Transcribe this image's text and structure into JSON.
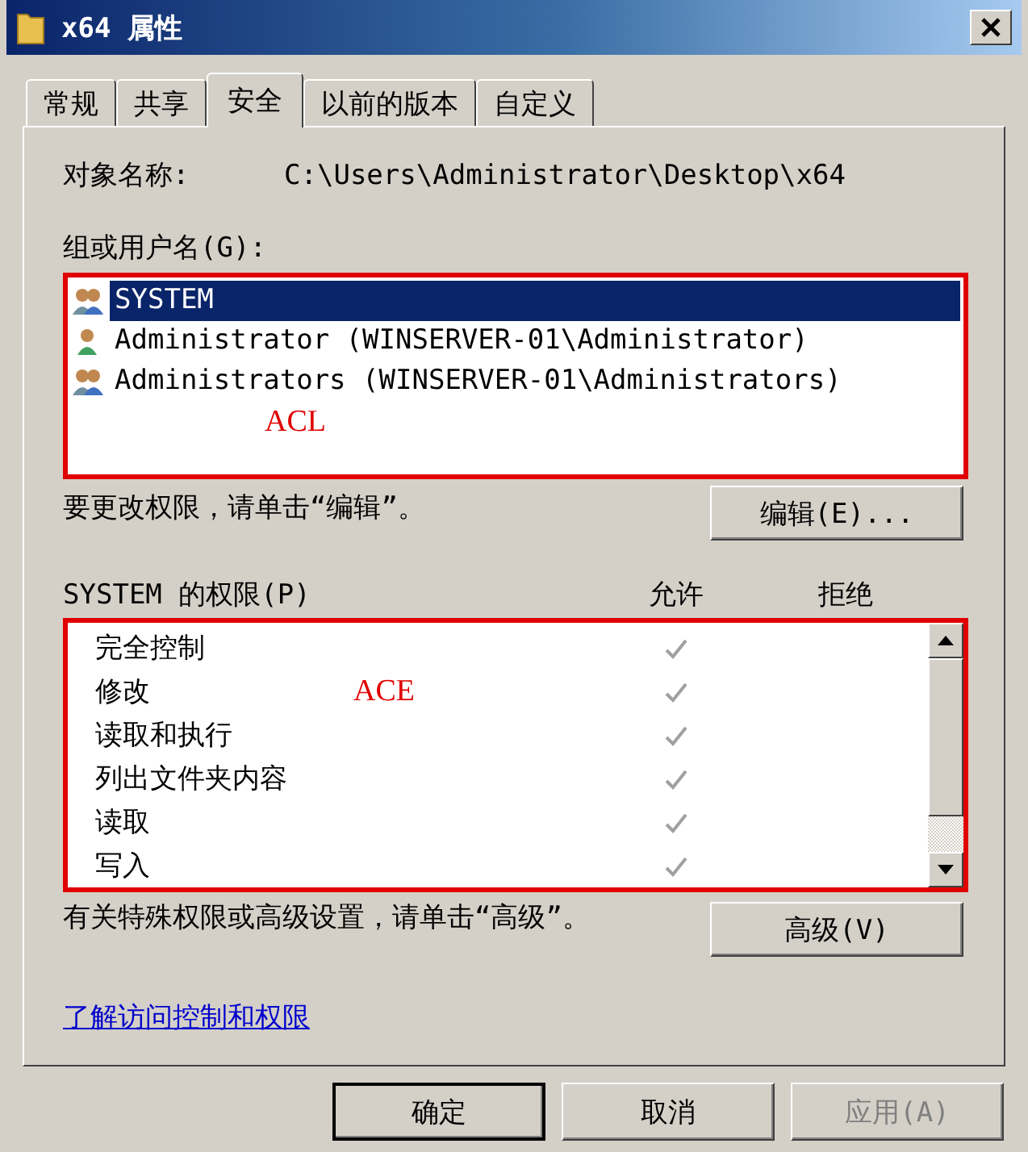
{
  "window": {
    "title": "x64 属性"
  },
  "tabs": [
    {
      "label": "常规",
      "selected": false
    },
    {
      "label": "共享",
      "selected": false
    },
    {
      "label": "安全",
      "selected": true
    },
    {
      "label": "以前的版本",
      "selected": false
    },
    {
      "label": "自定义",
      "selected": false
    }
  ],
  "object_name": {
    "label": "对象名称:",
    "value": "C:\\Users\\Administrator\\Desktop\\x64"
  },
  "groups": {
    "label": "组或用户名(G):",
    "annotation": "ACL",
    "users": [
      {
        "name": "SYSTEM",
        "kind": "group",
        "selected": true
      },
      {
        "name": "Administrator (WINSERVER-01\\Administrator)",
        "kind": "user",
        "selected": false
      },
      {
        "name": "Administrators (WINSERVER-01\\Administrators)",
        "kind": "group",
        "selected": false
      }
    ]
  },
  "edit_hint": "要更改权限，请单击“编辑”。",
  "edit_button": "编辑(E)...",
  "permissions": {
    "label": "SYSTEM 的权限(P)",
    "allow_header": "允许",
    "deny_header": "拒绝",
    "rows": [
      {
        "name": "完全控制",
        "allow": true,
        "deny": false
      },
      {
        "name": "修改",
        "allow": true,
        "deny": false,
        "note": "ACE"
      },
      {
        "name": "读取和执行",
        "allow": true,
        "deny": false
      },
      {
        "name": "列出文件夹内容",
        "allow": true,
        "deny": false
      },
      {
        "name": "读取",
        "allow": true,
        "deny": false
      },
      {
        "name": "写入",
        "allow": true,
        "deny": false
      }
    ]
  },
  "advanced_hint": "有关特殊权限或高级设置，请单击“高级”。",
  "advanced_button": "高级(V)",
  "link": "了解访问控制和权限",
  "buttons": [
    {
      "label": "确定",
      "default": true,
      "disabled": false
    },
    {
      "label": "取消",
      "default": false,
      "disabled": false
    },
    {
      "label": "应用(A)",
      "default": false,
      "disabled": true
    }
  ]
}
